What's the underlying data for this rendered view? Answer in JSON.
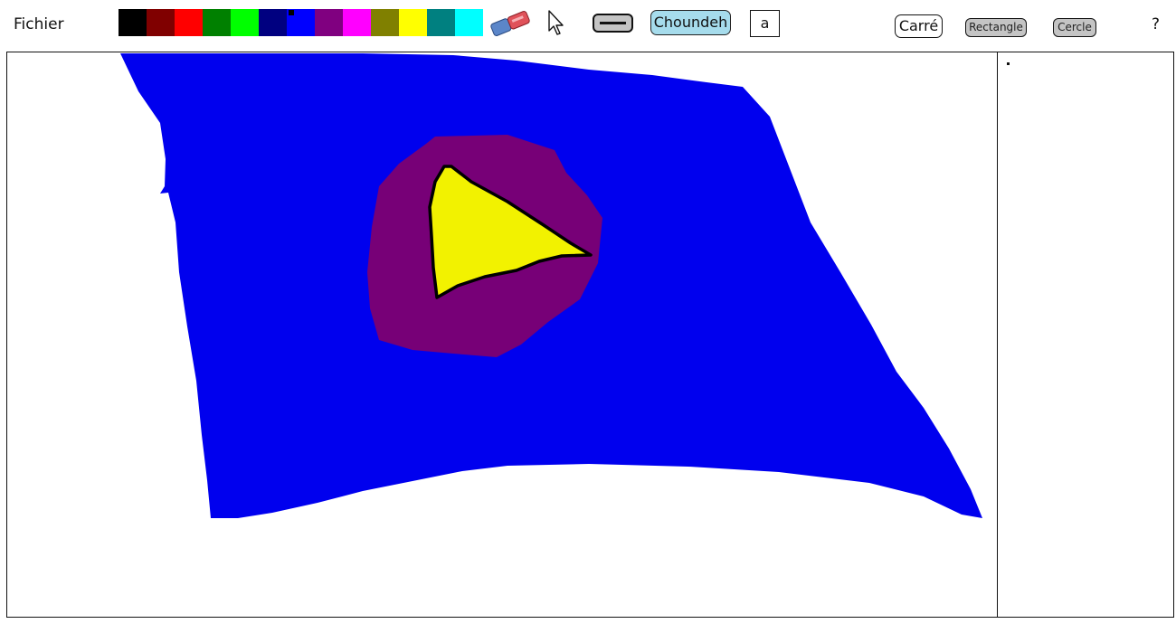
{
  "menu": {
    "file_label": "Fichier",
    "help_label": "?"
  },
  "palette": {
    "colors": [
      "#000000",
      "#800000",
      "#ff0000",
      "#008000",
      "#00ff00",
      "#000080",
      "#0000ff",
      "#800080",
      "#ff00ff",
      "#808000",
      "#ffff00",
      "#008080",
      "#00ffff"
    ],
    "selected_index": 6
  },
  "tools": {
    "eraser_icon": "eraser-icon",
    "pointer_icon": "cursor-arrow-icon",
    "stroke_icon": "line-width-icon",
    "choundeh_label": "Choundeh",
    "text_value": "a",
    "carre_label": "Carré",
    "rectangle_label": "Rectangle",
    "cercle_label": "Cercle"
  },
  "drawing": {
    "shape_colors": {
      "background_shape": "#0000ee",
      "middle_shape": "#770077",
      "inner_shape": "#f2f200",
      "inner_outline": "#000000"
    }
  }
}
